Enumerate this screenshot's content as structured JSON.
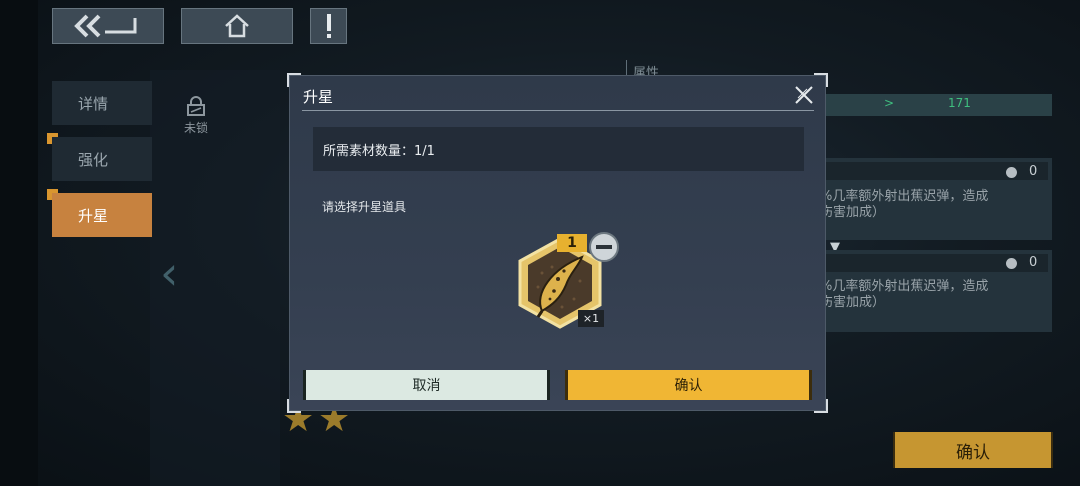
{
  "background": {
    "tabs": [
      {
        "label": "详情",
        "active": false
      },
      {
        "label": "强化",
        "active": false
      },
      {
        "label": "升星",
        "active": true
      }
    ],
    "lock_label": "未锁",
    "attr_label": "属性",
    "bar_arrow": ">",
    "bar_value": "171",
    "skills": [
      {
        "text": "%几率额外射出蕉迟弹，造成\n伤害加成）",
        "value": "0"
      },
      {
        "text": "%几率额外射出蕉迟弹，造成\n伤害加成）",
        "value": "0"
      }
    ],
    "confirm_label": "确认",
    "icons": {
      "back": "double-chevron-back-icon",
      "home": "home-icon",
      "alert": "exclamation-icon",
      "lock": "lock-icon",
      "prev": "chevron-left-icon",
      "star": "star-icon"
    },
    "colors": {
      "accent": "#c7823f",
      "gold": "#c69631",
      "green": "#3fbf7f"
    }
  },
  "modal": {
    "title": "升星",
    "required_materials": "所需素材数量：1/1",
    "select_prompt": "请选择升星道具",
    "item": {
      "name_icon": "banana-icon",
      "badge": "1",
      "quantity": "×1",
      "remove_icon": "minus-circle-icon"
    },
    "cancel_label": "取消",
    "confirm_label": "确认",
    "close_icon": "close-icon",
    "colors": {
      "confirm": "#f0b634",
      "cancel": "#dce9e2",
      "panel": "#343f50"
    }
  }
}
